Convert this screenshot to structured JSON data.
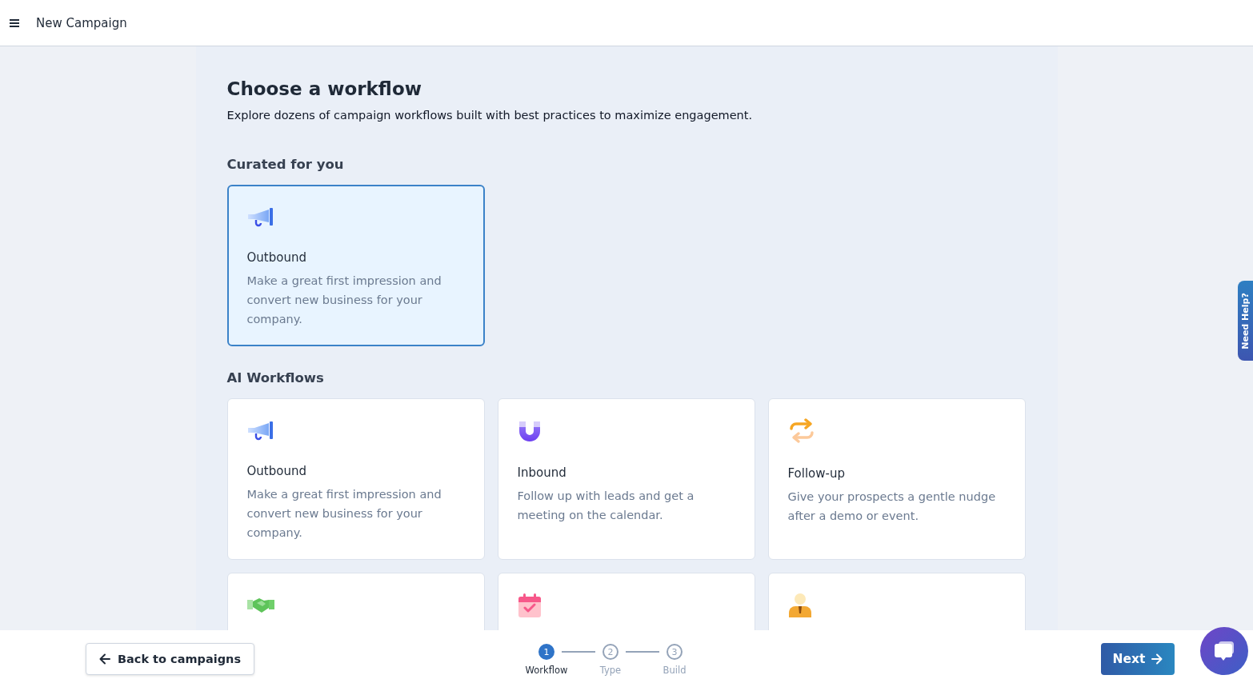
{
  "header": {
    "title": "New Campaign"
  },
  "page": {
    "heading": "Choose a workflow",
    "subtitle": "Explore dozens of campaign workflows built with best practices to maximize engagement."
  },
  "sections": [
    {
      "title": "Curated for you",
      "cards": [
        {
          "title": "Outbound",
          "description": "Make a great first impression and convert new business for your company.",
          "selected": true
        }
      ]
    },
    {
      "title": "AI Workflows",
      "cards": [
        {
          "title": "Outbound",
          "description": "Make a great first impression and convert new business for your company.",
          "selected": false
        },
        {
          "title": "Inbound",
          "description": "Follow up with leads and get a meeting on the calendar.",
          "selected": false
        },
        {
          "title": "Follow-up",
          "description": "Give your prospects a gentle nudge after a demo or event.",
          "selected": false
        },
        {
          "selected": false
        },
        {
          "selected": false
        },
        {
          "selected": false
        }
      ]
    }
  ],
  "help_tab": {
    "label": "Need Help?"
  },
  "footer": {
    "back_button": "Back to campaigns",
    "next_button": "Next",
    "steps": [
      {
        "number": "1",
        "label": "Workflow",
        "selected": true
      },
      {
        "number": "2",
        "label": "Type",
        "selected": false
      },
      {
        "number": "3",
        "label": "Build",
        "selected": false
      }
    ]
  }
}
